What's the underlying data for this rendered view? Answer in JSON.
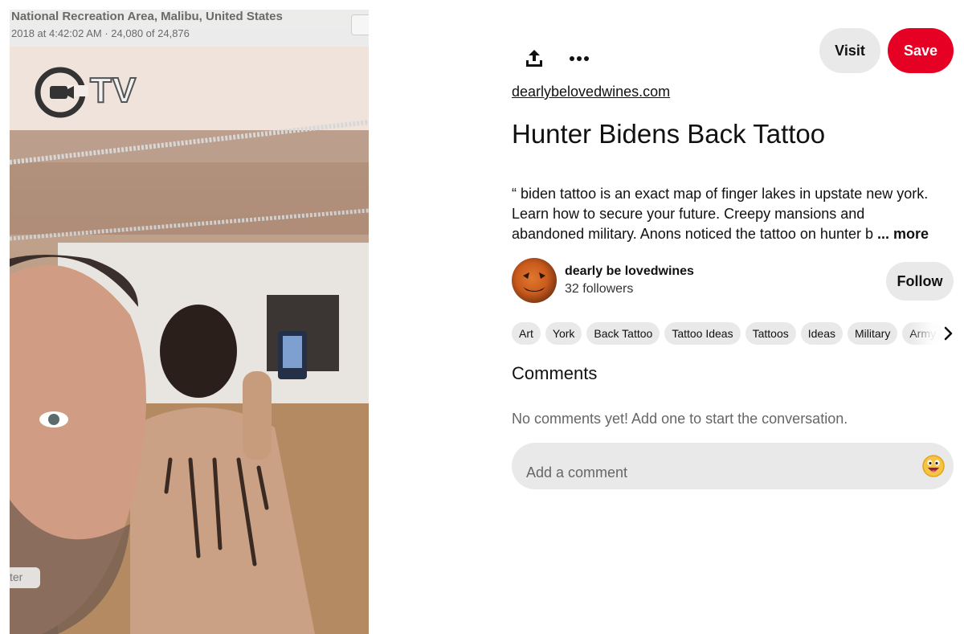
{
  "photo": {
    "caption_location": "National Recreation Area, Malibu, United States",
    "caption_meta": "2018 at 4:42:02 AM  ·  24,080 of 24,876",
    "logo_text": "TV",
    "badge_text": "ter"
  },
  "toolbar": {
    "share_icon": "share-upload-icon",
    "more_icon": "ellipsis-icon",
    "visit_label": "Visit",
    "save_label": "Save"
  },
  "pin": {
    "source": "dearlybelovedwines.com",
    "title": "Hunter Bidens Back Tattoo",
    "description_lines": [
      "“ biden tattoo is an exact map of finger lakes in upstate new york.",
      "Learn how to secure your future. Creepy mansions and",
      "abandoned military. Anons noticed the tattoo on hunter b"
    ],
    "more_label": "... more"
  },
  "creator": {
    "name": "dearly be lovedwines",
    "followers": "32 followers",
    "follow_label": "Follow"
  },
  "tags": [
    "Art",
    "York",
    "Back Tattoo",
    "Tattoo Ideas",
    "Tattoos",
    "Ideas",
    "Military",
    "Army"
  ],
  "comments": {
    "heading": "Comments",
    "empty_text": "No comments yet! Add one to start the conversation.",
    "placeholder": "Add a comment"
  },
  "colors": {
    "save": "#e60023",
    "pill": "#e9e9e9",
    "text": "#111111",
    "muted": "#666666"
  }
}
